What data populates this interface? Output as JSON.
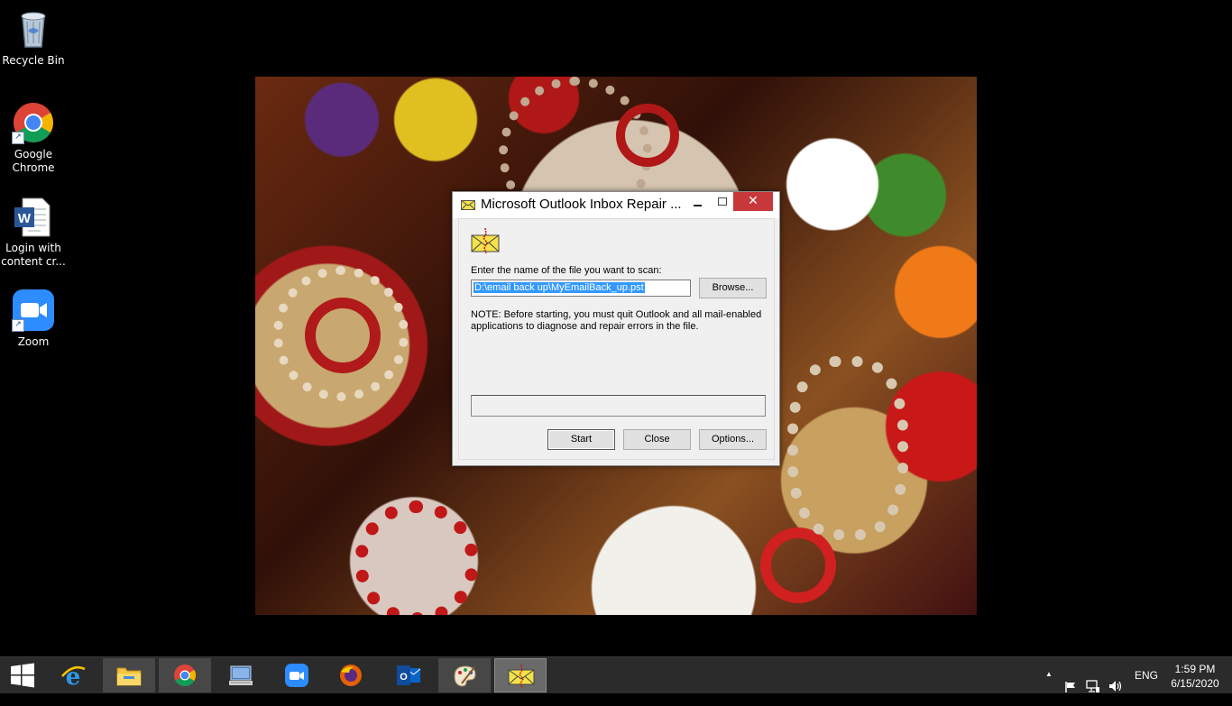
{
  "desktop": {
    "icons": [
      {
        "label": "Recycle Bin",
        "icon": "recycle-bin-icon"
      },
      {
        "label": "Google Chrome",
        "icon": "chrome-icon"
      },
      {
        "label": "Login with content cr...",
        "icon": "word-document-icon"
      },
      {
        "label": "Zoom",
        "icon": "zoom-icon"
      }
    ]
  },
  "dialog": {
    "title": "Microsoft Outlook Inbox Repair ...",
    "prompt": "Enter the name of the file you want to scan:",
    "file_path": "D:\\email back up\\MyEmailBack_up.pst",
    "browse_label": "Browse...",
    "note_line1": "NOTE: Before starting, you must quit Outlook and all mail-enabled",
    "note_line2": "applications to diagnose and repair errors in the file.",
    "start_label": "Start",
    "close_label": "Close",
    "options_label": "Options...",
    "close_glyph": "✕"
  },
  "taskbar": {
    "items": [
      "windows-start-icon",
      "internet-explorer-icon",
      "file-explorer-icon",
      "chrome-icon",
      "remote-desktop-icon",
      "zoom-icon",
      "firefox-icon",
      "outlook-icon",
      "paint-icon",
      "inbox-repair-icon"
    ],
    "tray": {
      "language": "ENG",
      "time": "1:59 PM",
      "date": "6/15/2020",
      "up_arrow": "▲"
    }
  },
  "colors": {
    "close_red": "#c7383a",
    "taskbar_bg": "#2b2b2b",
    "selection_blue": "#3399ff"
  }
}
